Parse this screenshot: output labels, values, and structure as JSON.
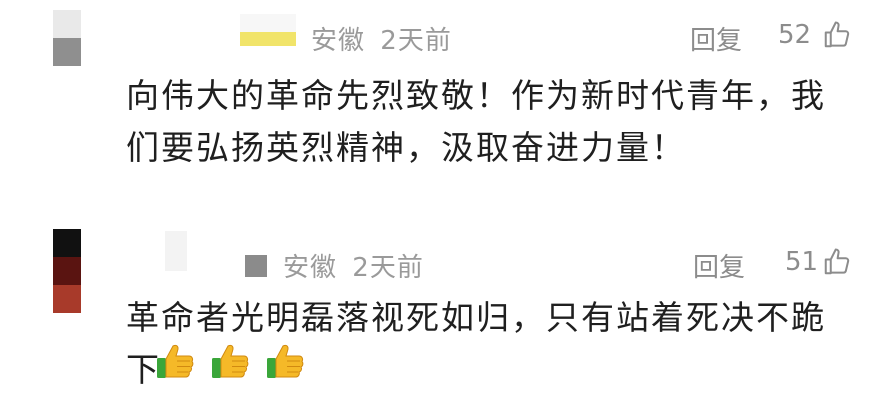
{
  "comments": [
    {
      "location": "安徽",
      "time": "2天前",
      "reply_label": "回复",
      "likes": "52",
      "text": "向伟大的革命先烈致敬！作为新时代青年，我们要弘扬英烈精神，汲取奋进力量！",
      "emojis": []
    },
    {
      "location": "安徽",
      "time": "2天前",
      "reply_label": "回复",
      "likes": "51",
      "text": "革命者光明磊落视死如归，只有站着死决不跪下",
      "emojis": [
        "thumbs-up-icon",
        "thumbs-up-icon",
        "thumbs-up-icon"
      ]
    }
  ],
  "colors": {
    "meta": "#9a9a9a",
    "text": "#1f1f1f",
    "thumb": "#f5b928",
    "thumb_cuff": "#3aa63a"
  }
}
